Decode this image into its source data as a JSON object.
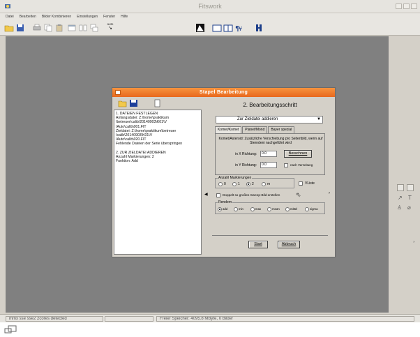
{
  "app": {
    "title": "Fitswork",
    "menu": [
      "Datei",
      "Bearbeiten",
      "Bilder Kombinieren",
      "Einstellungen",
      "Fenster",
      "Hilfe"
    ],
    "toolbar_auto_label": "auto"
  },
  "dialog": {
    "title": "Stapel Bearbeitung",
    "step_title": "2. Bearbeitungsschritt",
    "log_lines": [
      "1. DATEIEN FESTLEGEN",
      "Anfangsdatei: Z:\\home\\praktikum",
      "\\betreuer\\calib\\20140903\\K01\\V",
      "\\Auto\\calib\\001.FIT",
      "Zieldatei: Z:\\home\\praktikum\\betreuer",
      "\\calib\\20140903\\K01\\V",
      "\\Auto\\calib\\020.FIT",
      "Fehlende Dateien der Serie überspringen",
      "",
      "2. ZUR ZIELDATEI ADDIEREN",
      "Anzahl Markierungen: 2",
      "Funktion: Add"
    ],
    "select_value": "Zur Zieldatei addieren",
    "tabs": [
      "Komet/Komet",
      "Planet/Mond",
      "Bayer spezial"
    ],
    "description": "Komet/Asteroid: Zusätzliche Verschiebung pro Seitenbild, wenn auf Sterndeni nachgeführt wird",
    "x_label": "in X Richtung:",
    "x_value": "0.0",
    "y_label": "in Y Richtung:",
    "y_value": "0.0",
    "calc_button": "Berechnen",
    "auto_label": "nach Verzeitung",
    "marks_group": "Anzahl Markierungen",
    "marks_options": [
      "0",
      "1",
      "2",
      "m"
    ],
    "marks_selected_index": 2,
    "vliste_label": "VListe",
    "double_label": "Doppelt so großes Sweep-Bild erstellen",
    "rank_group": "Rendern",
    "rank_options": [
      "add",
      "min",
      "max",
      "mean",
      "mittel",
      "sigma"
    ],
    "rank_selected_index": 0,
    "start_button": "Start",
    "cancel_button": "Abbruch"
  },
  "status": {
    "cpu": "mmx sse sse2 2cores detected",
    "memory": "Freier Speicher: 4095.8 MByte, 0 Bilder"
  },
  "colors": {
    "titlebar_orange": "#e8681d",
    "workspace": "#808080"
  }
}
